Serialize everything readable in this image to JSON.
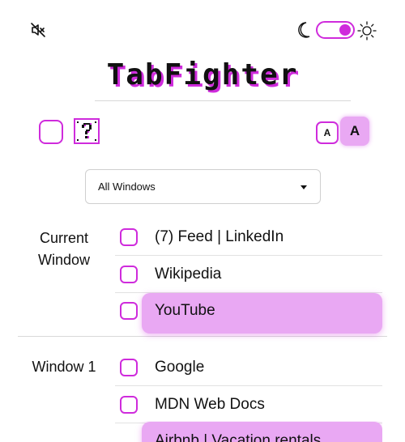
{
  "header": {
    "mute_icon": "volume-mute-icon",
    "moon_icon": "moon-icon",
    "sun_icon": "sun-icon",
    "theme_toggle_on": true
  },
  "title": "TabFighter",
  "controls": {
    "help_icon": "question-block-icon",
    "font_small_label": "A",
    "font_large_label": "A"
  },
  "window_select": {
    "value": "All Windows"
  },
  "groups": [
    {
      "label": "Current Window",
      "tabs": [
        {
          "title": "(7) Feed | LinkedIn",
          "highlighted": false
        },
        {
          "title": "Wikipedia",
          "highlighted": false
        },
        {
          "title": "YouTube",
          "highlighted": true
        }
      ]
    },
    {
      "label": "Window 1",
      "tabs": [
        {
          "title": "Google",
          "highlighted": false
        },
        {
          "title": "MDN Web Docs",
          "highlighted": false
        },
        {
          "title": "Airbnb | Vacation rentals",
          "highlighted": true
        }
      ]
    }
  ],
  "colors": {
    "accent": "#cf2bdc",
    "highlight": "#e9a8f3"
  }
}
